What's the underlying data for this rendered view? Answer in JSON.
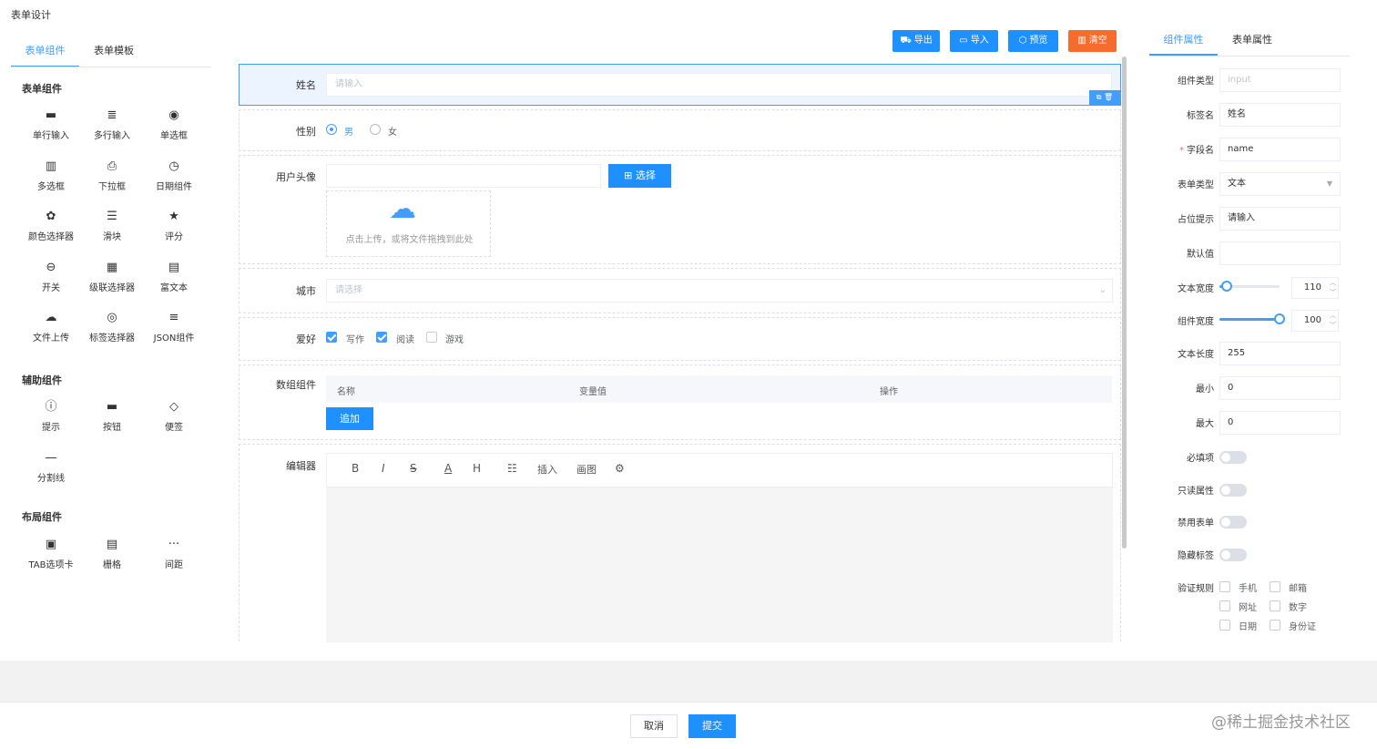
{
  "page_title": "表单设计",
  "left_tabs": [
    "表单组件",
    "表单模板"
  ],
  "sections": {
    "form": "表单组件",
    "aux": "辅助组件",
    "layout": "布局组件"
  },
  "form_components": [
    {
      "label": "单行输入",
      "icon": "▬"
    },
    {
      "label": "多行输入",
      "icon": "≣"
    },
    {
      "label": "单选框",
      "icon": "◉"
    },
    {
      "label": "多选框",
      "icon": "▥"
    },
    {
      "label": "下拉框",
      "icon": "⎙"
    },
    {
      "label": "日期组件",
      "icon": "◷"
    },
    {
      "label": "颜色选择器",
      "icon": "✿"
    },
    {
      "label": "滑块",
      "icon": "☰"
    },
    {
      "label": "评分",
      "icon": "★"
    },
    {
      "label": "开关",
      "icon": "⊖"
    },
    {
      "label": "级联选择器",
      "icon": "▦"
    },
    {
      "label": "富文本",
      "icon": "▤"
    },
    {
      "label": "文件上传",
      "icon": "☁"
    },
    {
      "label": "标签选择器",
      "icon": "◎"
    },
    {
      "label": "JSON组件",
      "icon": "≡"
    }
  ],
  "aux_components": [
    {
      "label": "提示",
      "icon": "ⓘ"
    },
    {
      "label": "按钮",
      "icon": "▬"
    },
    {
      "label": "便签",
      "icon": "◇"
    },
    {
      "label": "分割线",
      "icon": "—"
    }
  ],
  "layout_components": [
    {
      "label": "TAB选项卡",
      "icon": "▣"
    },
    {
      "label": "栅格",
      "icon": "▤"
    },
    {
      "label": "间距",
      "icon": "···"
    }
  ],
  "toolbar": {
    "export": "导出",
    "import": "导入",
    "preview": "预览",
    "clear": "清空"
  },
  "form": {
    "name_label": "姓名",
    "name_placeholder": "请输入",
    "gender_label": "性别",
    "gender_male": "男",
    "gender_female": "女",
    "avatar_label": "用户头像",
    "avatar_button": "选择",
    "upload_hint": "点击上传，或将文件拖拽到此处",
    "city_label": "城市",
    "city_placeholder": "请选择",
    "hobby_label": "爱好",
    "hobbies": [
      "写作",
      "阅读",
      "游戏"
    ],
    "array_label": "数组组件",
    "array_columns": [
      "名称",
      "变量值",
      "操作"
    ],
    "array_add": "追加",
    "editor_label": "编辑器",
    "editor_tools": [
      "B",
      "I",
      "S",
      "A",
      "H",
      "☷",
      "插入",
      "画图",
      "⚙"
    ]
  },
  "right_tabs": [
    "组件属性",
    "表单属性"
  ],
  "props": {
    "type_label": "组件类型",
    "type_value": "input",
    "tag_label": "标签名",
    "tag_value": "姓名",
    "field_label": "字段名",
    "field_value": "name",
    "form_type_label": "表单类型",
    "form_type_value": "文本",
    "placeholder_label": "占位提示",
    "placeholder_value": "请输入",
    "default_label": "默认值",
    "default_value": "",
    "text_width_label": "文本宽度",
    "text_width_value": "110",
    "text_width_fraction": 0.12,
    "comp_width_label": "组件宽度",
    "comp_width_value": "100",
    "comp_width_fraction": 1.0,
    "text_length_label": "文本长度",
    "text_length_value": "255",
    "min_label": "最小",
    "min_value": "0",
    "max_label": "最大",
    "max_value": "0",
    "required_label": "必填项",
    "readonly_label": "只读属性",
    "disabled_label": "禁用表单",
    "hidden_label": "隐藏标签",
    "rules_label": "验证规则",
    "rules": [
      "手机",
      "邮箱",
      "网址",
      "数字",
      "日期",
      "身份证"
    ]
  },
  "footer": {
    "cancel": "取消",
    "submit": "提交"
  },
  "watermark": "@稀土掘金技术社区",
  "colors": {
    "primary": "#1e90ff",
    "danger": "#f56c2c",
    "active_bg": "#ecf5ff"
  }
}
